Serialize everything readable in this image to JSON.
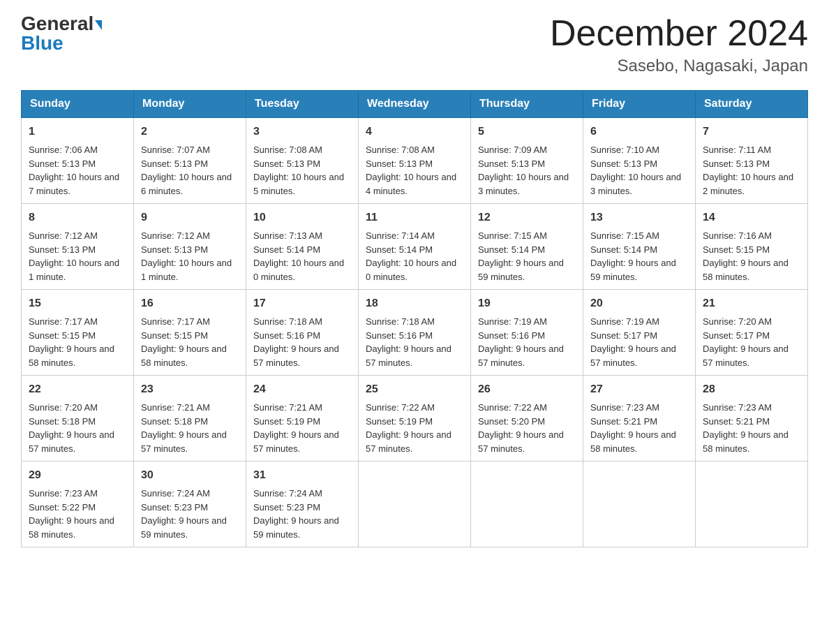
{
  "header": {
    "logo_general": "General",
    "logo_blue": "Blue",
    "title": "December 2024",
    "subtitle": "Sasebo, Nagasaki, Japan"
  },
  "columns": [
    "Sunday",
    "Monday",
    "Tuesday",
    "Wednesday",
    "Thursday",
    "Friday",
    "Saturday"
  ],
  "weeks": [
    [
      {
        "day": "1",
        "sunrise": "7:06 AM",
        "sunset": "5:13 PM",
        "daylight": "10 hours and 7 minutes."
      },
      {
        "day": "2",
        "sunrise": "7:07 AM",
        "sunset": "5:13 PM",
        "daylight": "10 hours and 6 minutes."
      },
      {
        "day": "3",
        "sunrise": "7:08 AM",
        "sunset": "5:13 PM",
        "daylight": "10 hours and 5 minutes."
      },
      {
        "day": "4",
        "sunrise": "7:08 AM",
        "sunset": "5:13 PM",
        "daylight": "10 hours and 4 minutes."
      },
      {
        "day": "5",
        "sunrise": "7:09 AM",
        "sunset": "5:13 PM",
        "daylight": "10 hours and 3 minutes."
      },
      {
        "day": "6",
        "sunrise": "7:10 AM",
        "sunset": "5:13 PM",
        "daylight": "10 hours and 3 minutes."
      },
      {
        "day": "7",
        "sunrise": "7:11 AM",
        "sunset": "5:13 PM",
        "daylight": "10 hours and 2 minutes."
      }
    ],
    [
      {
        "day": "8",
        "sunrise": "7:12 AM",
        "sunset": "5:13 PM",
        "daylight": "10 hours and 1 minute."
      },
      {
        "day": "9",
        "sunrise": "7:12 AM",
        "sunset": "5:13 PM",
        "daylight": "10 hours and 1 minute."
      },
      {
        "day": "10",
        "sunrise": "7:13 AM",
        "sunset": "5:14 PM",
        "daylight": "10 hours and 0 minutes."
      },
      {
        "day": "11",
        "sunrise": "7:14 AM",
        "sunset": "5:14 PM",
        "daylight": "10 hours and 0 minutes."
      },
      {
        "day": "12",
        "sunrise": "7:15 AM",
        "sunset": "5:14 PM",
        "daylight": "9 hours and 59 minutes."
      },
      {
        "day": "13",
        "sunrise": "7:15 AM",
        "sunset": "5:14 PM",
        "daylight": "9 hours and 59 minutes."
      },
      {
        "day": "14",
        "sunrise": "7:16 AM",
        "sunset": "5:15 PM",
        "daylight": "9 hours and 58 minutes."
      }
    ],
    [
      {
        "day": "15",
        "sunrise": "7:17 AM",
        "sunset": "5:15 PM",
        "daylight": "9 hours and 58 minutes."
      },
      {
        "day": "16",
        "sunrise": "7:17 AM",
        "sunset": "5:15 PM",
        "daylight": "9 hours and 58 minutes."
      },
      {
        "day": "17",
        "sunrise": "7:18 AM",
        "sunset": "5:16 PM",
        "daylight": "9 hours and 57 minutes."
      },
      {
        "day": "18",
        "sunrise": "7:18 AM",
        "sunset": "5:16 PM",
        "daylight": "9 hours and 57 minutes."
      },
      {
        "day": "19",
        "sunrise": "7:19 AM",
        "sunset": "5:16 PM",
        "daylight": "9 hours and 57 minutes."
      },
      {
        "day": "20",
        "sunrise": "7:19 AM",
        "sunset": "5:17 PM",
        "daylight": "9 hours and 57 minutes."
      },
      {
        "day": "21",
        "sunrise": "7:20 AM",
        "sunset": "5:17 PM",
        "daylight": "9 hours and 57 minutes."
      }
    ],
    [
      {
        "day": "22",
        "sunrise": "7:20 AM",
        "sunset": "5:18 PM",
        "daylight": "9 hours and 57 minutes."
      },
      {
        "day": "23",
        "sunrise": "7:21 AM",
        "sunset": "5:18 PM",
        "daylight": "9 hours and 57 minutes."
      },
      {
        "day": "24",
        "sunrise": "7:21 AM",
        "sunset": "5:19 PM",
        "daylight": "9 hours and 57 minutes."
      },
      {
        "day": "25",
        "sunrise": "7:22 AM",
        "sunset": "5:19 PM",
        "daylight": "9 hours and 57 minutes."
      },
      {
        "day": "26",
        "sunrise": "7:22 AM",
        "sunset": "5:20 PM",
        "daylight": "9 hours and 57 minutes."
      },
      {
        "day": "27",
        "sunrise": "7:23 AM",
        "sunset": "5:21 PM",
        "daylight": "9 hours and 58 minutes."
      },
      {
        "day": "28",
        "sunrise": "7:23 AM",
        "sunset": "5:21 PM",
        "daylight": "9 hours and 58 minutes."
      }
    ],
    [
      {
        "day": "29",
        "sunrise": "7:23 AM",
        "sunset": "5:22 PM",
        "daylight": "9 hours and 58 minutes."
      },
      {
        "day": "30",
        "sunrise": "7:24 AM",
        "sunset": "5:23 PM",
        "daylight": "9 hours and 59 minutes."
      },
      {
        "day": "31",
        "sunrise": "7:24 AM",
        "sunset": "5:23 PM",
        "daylight": "9 hours and 59 minutes."
      },
      null,
      null,
      null,
      null
    ]
  ]
}
